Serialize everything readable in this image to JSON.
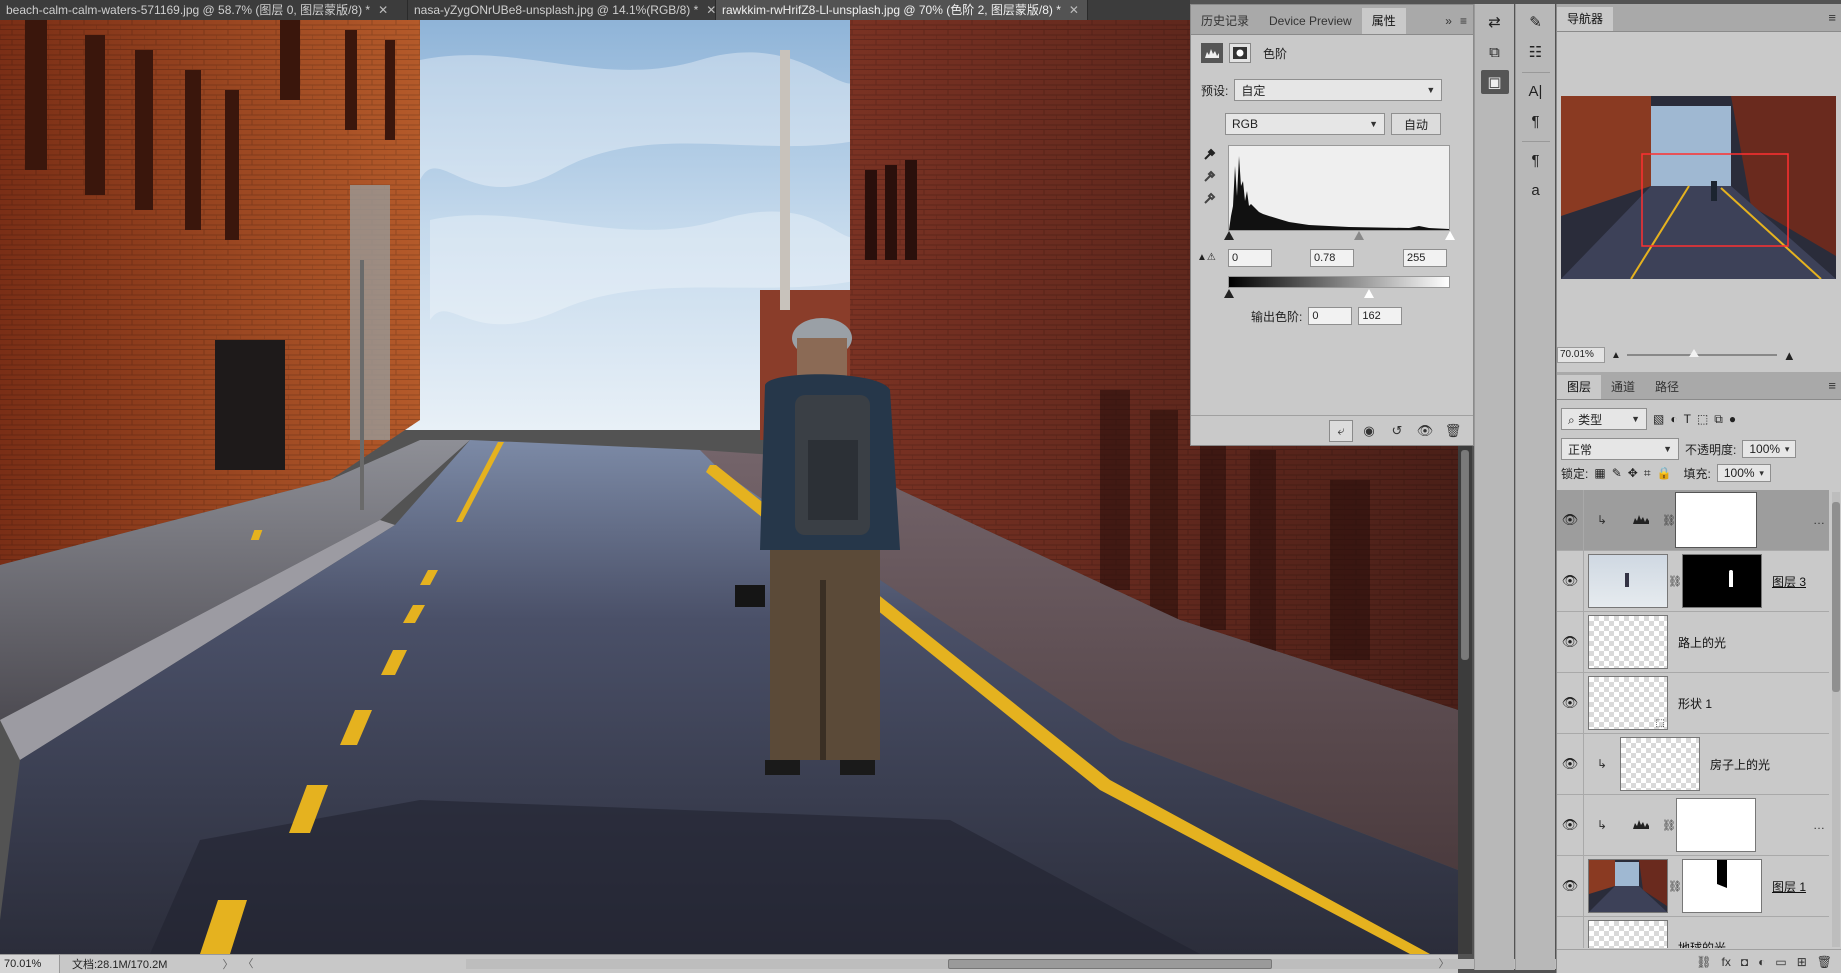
{
  "document_tabs": [
    {
      "label": "beach-calm-calm-waters-571169.jpg @ 58.7% (图层 0, 图层蒙版/8) *"
    },
    {
      "label": "nasa-yZygONrUBe8-unsplash.jpg @ 14.1%(RGB/8) *"
    },
    {
      "label": "rawkkim-rwHrifZ8-Ll-unsplash.jpg @ 70% (色阶 2, 图层蒙版/8) *"
    }
  ],
  "status_bar": {
    "zoom": "70.01%",
    "doc_size": "文档:28.1M/170.2M",
    "arrow": "〉",
    "prev_arrow": "〈",
    "next_arrow": "〉"
  },
  "properties_panel": {
    "tabs": [
      "历史记录",
      "Device Preview",
      "属性"
    ],
    "active_tab": "属性",
    "adjustment_title": "色阶",
    "preset_label": "预设:",
    "preset_value": "自定",
    "channel_value": "RGB",
    "auto_button": "自动",
    "input_black": "0",
    "input_gamma": "0.78",
    "input_white": "255",
    "output_label": "输出色阶:",
    "output_black": "0",
    "output_white": "162",
    "output_white_fraction": 0.635
  },
  "navigator": {
    "tab": "导航器",
    "zoom": "70.01%",
    "zoom_level_fraction": 0.45
  },
  "layers_panel": {
    "tabs": [
      "图层",
      "通道",
      "路径"
    ],
    "filter_kind": "类型",
    "blend_mode": "正常",
    "opacity_label": "不透明度:",
    "opacity_value": "100%",
    "lock_label": "锁定:",
    "fill_label": "填充:",
    "fill_value": "100%",
    "layers": [
      {
        "name": "",
        "type": "levels",
        "selected": true,
        "clipped": true
      },
      {
        "name": "图层 3",
        "type": "image-mask",
        "selected": false
      },
      {
        "name": "路上的光",
        "type": "transparent",
        "selected": false
      },
      {
        "name": "形状 1",
        "type": "shape",
        "selected": false
      },
      {
        "name": "房子上的光",
        "type": "transparent",
        "selected": false,
        "clipped": true
      },
      {
        "name": "",
        "type": "levels",
        "selected": false,
        "clipped": true
      },
      {
        "name": "图层 1",
        "type": "image-mask",
        "selected": false
      },
      {
        "name": "地球的光",
        "type": "transparent",
        "selected": false
      }
    ]
  },
  "colors": {
    "panel_bg": "#c9c9c9",
    "tab_bg": "#a9a9a9",
    "nav_view_rect": "#ff3030"
  }
}
